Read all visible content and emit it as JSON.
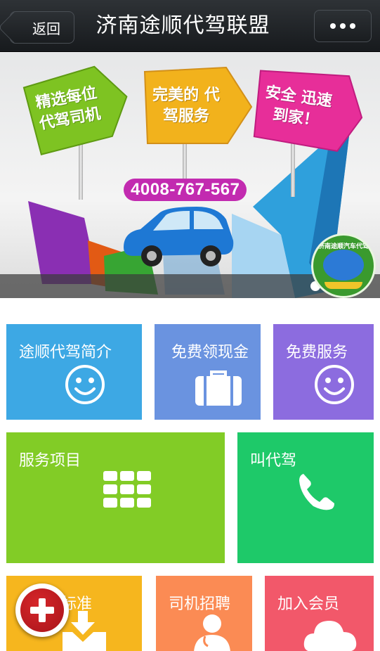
{
  "nav": {
    "back_label": "返回",
    "title": "济南途顺代驾联盟",
    "more_icon": "more-dots-icon"
  },
  "banner": {
    "signs": [
      {
        "text": "精选每位 代驾司机",
        "color": "#7ec322"
      },
      {
        "text": "完美的 代驾服务",
        "color": "#f2b21c"
      },
      {
        "text": "安全 迅速 到家！",
        "color": "#e72e99"
      }
    ],
    "phone": "4008-767-567",
    "slides_total": 2,
    "slide_active": 1,
    "badge_text": "济南途顺汽车代驾"
  },
  "tiles": [
    {
      "label": "途顺代驾简介",
      "icon": "smiley-icon",
      "color": "#3da8e4"
    },
    {
      "label": "免费领现金",
      "icon": "briefcase-icon",
      "color": "#6a93e0"
    },
    {
      "label": "免费服务",
      "icon": "smiley-icon",
      "color": "#8c6cdf"
    },
    {
      "label": "服务项目",
      "icon": "grid-icon",
      "color": "#82cc26"
    },
    {
      "label": "叫代驾",
      "icon": "phone-icon",
      "color": "#1ec969"
    },
    {
      "label": "标准",
      "icon": "download-icon",
      "color": "#f6b61e"
    },
    {
      "label": "司机招聘",
      "icon": "doctor-icon",
      "color": "#fb8b54"
    },
    {
      "label": "加入会员",
      "icon": "cloud-icon",
      "color": "#f2586a"
    }
  ],
  "fab": {
    "icon": "plus-icon"
  }
}
